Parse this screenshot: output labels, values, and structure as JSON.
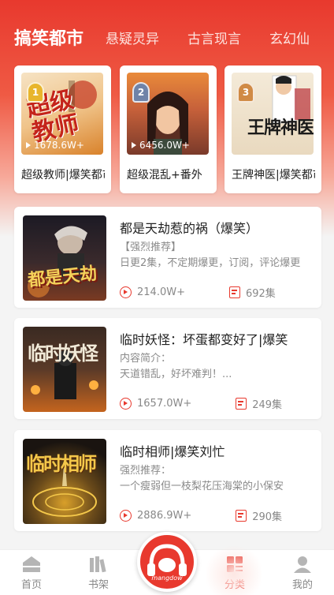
{
  "tabs": [
    "搞笑都市",
    "悬疑灵异",
    "古言现言",
    "玄幻仙"
  ],
  "ranked": [
    {
      "rank": "1",
      "plays": "1678.6W+",
      "title": "超级教师|爆笑都市",
      "cover_text": "超级教师",
      "badge_color": "#e8b52c"
    },
    {
      "rank": "2",
      "plays": "6456.0W+",
      "title": "超级混乱+番外",
      "cover_text": "",
      "badge_color": "#8a9bb5"
    },
    {
      "rank": "3",
      "plays": "",
      "title": "王牌神医|爆笑都市",
      "cover_text": "王牌神医",
      "badge_color": "#d08a45"
    }
  ],
  "list": [
    {
      "title": "都是天劫惹的祸（爆笑）",
      "desc1": "【强烈推荐】",
      "desc2": "日更2集，不定期爆更，订阅，评论爆更",
      "plays": "214.0W+",
      "episodes": "692集",
      "cover_text": "都是天劫"
    },
    {
      "title": "临时妖怪：坏蛋都变好了|爆笑",
      "desc1": "内容简介：",
      "desc2": "天道错乱，好坏难判！...",
      "plays": "1657.0W+",
      "episodes": "249集",
      "cover_text": "临时妖怪"
    },
    {
      "title": "临时相师|爆笑刘忙",
      "desc1": "强烈推荐：",
      "desc2": "一个瘦弱但一枝梨花压海棠的小保安",
      "plays": "2886.9W+",
      "episodes": "290集",
      "cover_text": "临时相师"
    }
  ],
  "nav": {
    "home": "首页",
    "shelf": "书架",
    "center_brand": "mangdow",
    "category": "分类",
    "mine": "我的"
  },
  "colors": {
    "accent": "#e8392e"
  }
}
